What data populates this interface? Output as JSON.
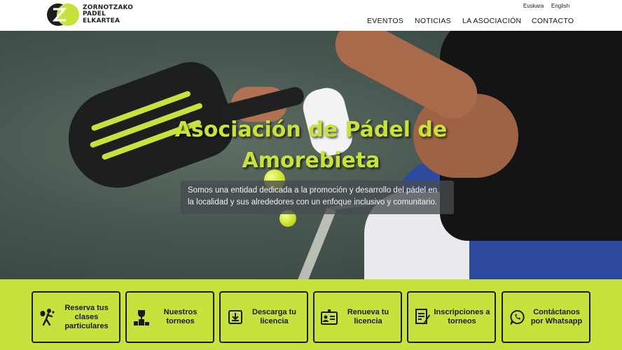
{
  "brand": {
    "line1": "ZORNOTZAKO",
    "line2": "PADEL",
    "line3": "ELKARTEA",
    "accent": "#c5e33c"
  },
  "languages": [
    "Euskara",
    "English"
  ],
  "nav": [
    "EVENTOS",
    "NOTICIAS",
    "LA ASOCIACIÓN",
    "CONTACTO"
  ],
  "hero": {
    "title_line1": "Asociación de Pádel de",
    "title_line2": "Amorebieta",
    "desc_line1": "Somos una entidad dedicada a la promoción y desarrollo del pádel en",
    "desc_line2": "la localidad y sus alrededores con un enfoque inclusivo y comunitario."
  },
  "tiles": [
    {
      "label": "Reserva tus clases particulares",
      "icon": "padel-player-icon"
    },
    {
      "label": "Nuestros torneos",
      "icon": "trophy-podium-icon"
    },
    {
      "label": "Descarga tu licencia",
      "icon": "download-icon"
    },
    {
      "label": "Renueva tu licencia",
      "icon": "id-card-icon"
    },
    {
      "label": "Inscripciones a torneos",
      "icon": "form-pencil-icon"
    },
    {
      "label": "Contáctanos por Whatsapp",
      "icon": "whatsapp-icon"
    }
  ]
}
